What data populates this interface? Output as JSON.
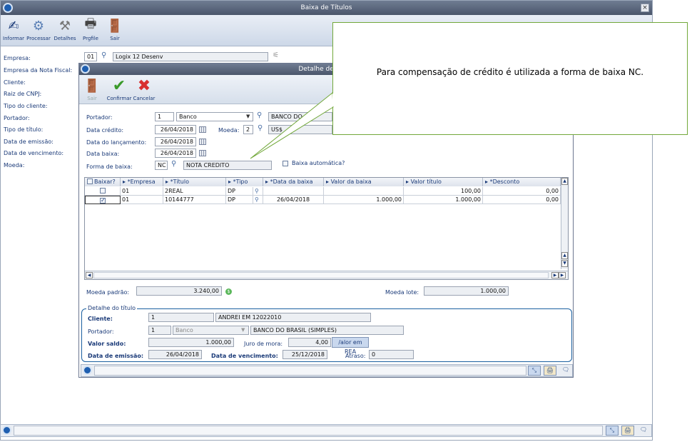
{
  "window": {
    "title": "Baixa de Títulos",
    "close": "×"
  },
  "toolbar": [
    {
      "label": "Informar",
      "icon": "pencil-icon"
    },
    {
      "label": "Processar",
      "icon": "gears-icon"
    },
    {
      "label": "Detalhes",
      "icon": "tools-icon"
    },
    {
      "label": "Prgfile",
      "icon": "user-printer-icon"
    },
    {
      "label": "Sair",
      "icon": "exit-door-icon"
    }
  ],
  "main": {
    "labels": [
      "Empresa:",
      "Empresa da Nota Fiscal:",
      "Cliente:",
      "Raiz de CNPJ:",
      "Tipo do cliente:",
      "Portador:",
      "Tipo de título:",
      "Data de emissão:",
      "Data de vencimento:",
      "Moeda:"
    ],
    "empresa_code": "01",
    "empresa_name": "Logix 12 Desenv"
  },
  "dialog": {
    "title": "Detalhe de Baixa",
    "toolbar": {
      "exit": "Sair",
      "confirm": "Confirmar",
      "cancel": "Cancelar"
    },
    "portador_label": "Portador:",
    "portador_code": "1",
    "portador_type": "Banco",
    "portador_name": "BANCO DO",
    "data_credito_label": "Data crédito:",
    "data_credito": "26/04/2018",
    "moeda_label": "Moeda:",
    "moeda_code": "2",
    "moeda_name": "US$",
    "data_lancamento_label": "Data do lançamento:",
    "data_lancamento": "26/04/2018",
    "data_baixa_label": "Data baixa:",
    "data_baixa": "26/04/2018",
    "forma_baixa_label": "Forma de  baixa:",
    "forma_code": "NC",
    "forma_name": "NOTA CREDITO",
    "baixa_automatica_label": "Baixa automática?",
    "grid": {
      "headers": [
        "Baixar?",
        "*Empresa",
        "*Título",
        "*Tipo",
        "*Data da baixa",
        "Valor da baixa",
        "Valor título",
        "*Desconto"
      ],
      "rows": [
        {
          "checked": false,
          "empresa": "01",
          "titulo": "2REAL",
          "tipo": "DP",
          "data": "",
          "valor_baixa": "",
          "valor_titulo": "100,00",
          "desconto": "0,00"
        },
        {
          "checked": true,
          "empresa": "01",
          "titulo": "10144777",
          "tipo": "DP",
          "data": "26/04/2018",
          "valor_baixa": "1.000,00",
          "valor_titulo": "1.000,00",
          "desconto": "0,00"
        }
      ]
    },
    "moeda_padrao_label": "Moeda padrão:",
    "moeda_padrao": "3.240,00",
    "moeda_lote_label": "Moeda lote:",
    "moeda_lote": "1.000,00",
    "detalhe": {
      "legend": "Detalhe do título",
      "cliente_label": "Cliente:",
      "cliente_code": "1",
      "cliente_name": "ANDREI EM 12022010",
      "portador_label": "Portador:",
      "portador_code": "1",
      "portador_type": "Banco",
      "portador_name": "BANCO DO BRASIL (SIMPLES)",
      "valor_saldo_label": "Valor saldo:",
      "valor_saldo": "1.000,00",
      "juro_label": "Juro de mora:",
      "juro": "4,00",
      "valor_rea_button": "/alor em REA",
      "emissao_label": "Data de emissão:",
      "emissao": "26/04/2018",
      "vencimento_label": "Data de vencimento:",
      "vencimento": "25/12/2018",
      "atraso_label": "Atraso:",
      "atraso": "0"
    }
  },
  "callout": {
    "text": "Para compensação de crédito é utilizada a forma de baixa NC."
  },
  "colors": {
    "accent": "#1a3a78",
    "callout_border": "#72a83a",
    "confirm": "#3a9a2a",
    "cancel": "#d83030"
  }
}
